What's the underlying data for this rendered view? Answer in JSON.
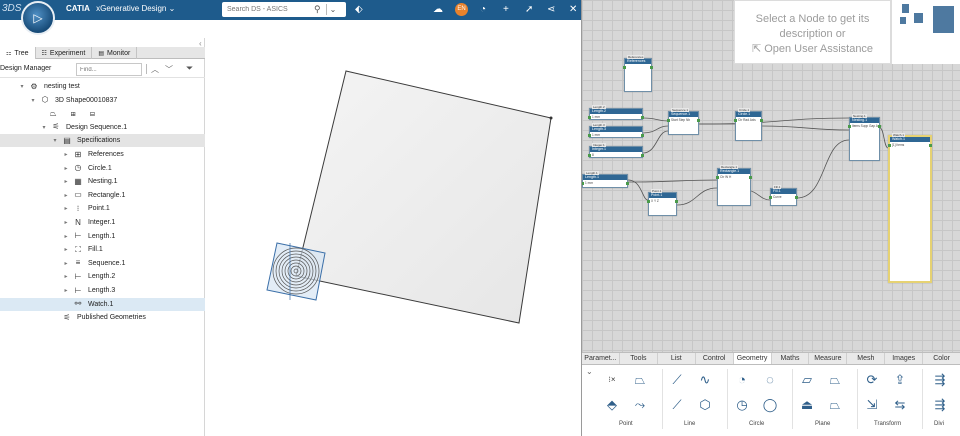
{
  "header": {
    "brand": "3DS",
    "app_name": "CATIA",
    "app_module": "xGenerative Design",
    "search_placeholder": "Search DS - ASICS",
    "user_initials": "EN"
  },
  "tree": {
    "tabs": [
      "Tree",
      "Experiment",
      "Monitor"
    ],
    "manager_label": "Design Manager",
    "find_placeholder": "Find...",
    "rows": [
      {
        "label": "nesting test",
        "indent": 0,
        "icon": "gear-icon",
        "twisty": "▾",
        "style": ""
      },
      {
        "label": "3D Shape00010837",
        "indent": 1,
        "icon": "shape-icon",
        "twisty": "▾",
        "style": ""
      },
      {
        "label": "",
        "indent": 2,
        "icon": "toolbar-icons",
        "twisty": "",
        "style": ""
      },
      {
        "label": "Design Sequence.1",
        "indent": 2,
        "icon": "sequence-icon",
        "twisty": "▾",
        "style": ""
      },
      {
        "label": "Specifications",
        "indent": 3,
        "icon": "specifications-icon",
        "twisty": "▾",
        "style": "band"
      },
      {
        "label": "References",
        "indent": 4,
        "icon": "references-icon",
        "twisty": "▸",
        "style": ""
      },
      {
        "label": "Circle.1",
        "indent": 4,
        "icon": "circle-icon",
        "twisty": "▸",
        "style": ""
      },
      {
        "label": "Nesting.1",
        "indent": 4,
        "icon": "nesting-icon",
        "twisty": "▸",
        "style": ""
      },
      {
        "label": "Rectangle.1",
        "indent": 4,
        "icon": "rectangle-icon",
        "twisty": "▸",
        "style": ""
      },
      {
        "label": "Point.1",
        "indent": 4,
        "icon": "point-icon",
        "twisty": "▸",
        "style": ""
      },
      {
        "label": "Integer.1",
        "indent": 4,
        "icon": "integer-icon",
        "twisty": "▸",
        "style": ""
      },
      {
        "label": "Length.1",
        "indent": 4,
        "icon": "length-icon",
        "twisty": "▸",
        "style": ""
      },
      {
        "label": "Fill.1",
        "indent": 4,
        "icon": "fill-icon",
        "twisty": "▸",
        "style": ""
      },
      {
        "label": "Sequence.1",
        "indent": 4,
        "icon": "sequence-list-icon",
        "twisty": "▸",
        "style": ""
      },
      {
        "label": "Length.2",
        "indent": 4,
        "icon": "length-icon",
        "twisty": "▸",
        "style": ""
      },
      {
        "label": "Length.3",
        "indent": 4,
        "icon": "length-icon",
        "twisty": "▸",
        "style": ""
      },
      {
        "label": "Watch.1",
        "indent": 4,
        "icon": "watch-icon",
        "twisty": "",
        "style": "selected"
      },
      {
        "label": "Published Geometries",
        "indent": 3,
        "icon": "published-icon",
        "twisty": "",
        "style": ""
      }
    ]
  },
  "info_panel": {
    "line1": "Select a Node to get its",
    "line2": "description or",
    "link": "Open User Assistance"
  },
  "graph": {
    "nodes": [
      {
        "id": "references",
        "tag": "References",
        "title": "References",
        "body": ""
      },
      {
        "id": "length2",
        "tag": "Length.2",
        "title": "Length.2",
        "body": "1 mm"
      },
      {
        "id": "length3",
        "tag": "Length.3",
        "title": "Length.3",
        "body": "1 mm"
      },
      {
        "id": "integer1",
        "tag": "Integer.1",
        "title": "Integer.1",
        "body": "8"
      },
      {
        "id": "sequence1",
        "tag": "Sequence.1",
        "title": "Sequence.1",
        "body": "Start Step Nb"
      },
      {
        "id": "circle1",
        "tag": "Circle.1",
        "title": "Circle.1",
        "body": "Ctr Rad Axis"
      },
      {
        "id": "nesting1",
        "tag": "Nesting.1",
        "title": "Nesting.1",
        "body": "Items Supp Gap Ang"
      },
      {
        "id": "watch1",
        "tag": "Watch.1",
        "title": "Watch.1",
        "body": "[1] Items"
      },
      {
        "id": "length1",
        "tag": "Length.1",
        "title": "Length.1",
        "body": "1 mm"
      },
      {
        "id": "point1",
        "tag": "Point.1",
        "title": "Point.1",
        "body": "X Y Z"
      },
      {
        "id": "rectangle1",
        "tag": "Rectangle.1",
        "title": "Rectangle.1",
        "body": "Ctr W H"
      },
      {
        "id": "fill1",
        "tag": "Fill.1",
        "title": "Fill.1",
        "body": "Curve"
      }
    ]
  },
  "library": {
    "tabs": [
      "Paramet...",
      "Tools",
      "List",
      "Control",
      "Geometry",
      "Maths",
      "Measure",
      "Mesh",
      "Images",
      "Color"
    ],
    "active_tab": "Geometry",
    "sections": [
      "Point",
      "Line",
      "Circle",
      "Plane",
      "Transform",
      "Divi"
    ]
  }
}
